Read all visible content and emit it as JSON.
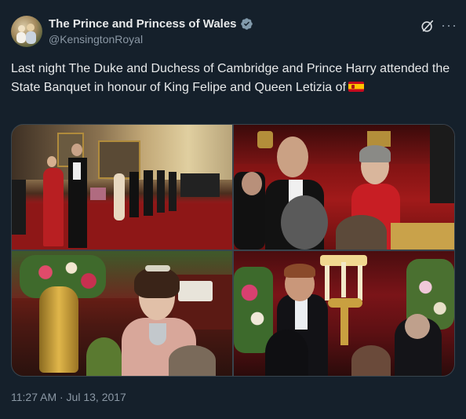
{
  "author": {
    "name": "The Prince and Princess of Wales",
    "handle": "@KensingtonRoyal",
    "verified_icon": "verified-badge-icon"
  },
  "header_icons": [
    "grok-icon",
    "more-options-icon"
  ],
  "more_label": "···",
  "tweet": {
    "text": "Last night The Duke and Duchess of Cambridge and Prince Harry attended the State Banquet in honour of King Felipe and Queen Letizia of",
    "emoji": "flag-spain"
  },
  "photos": [
    {
      "label": "photo-1"
    },
    {
      "label": "photo-2"
    },
    {
      "label": "photo-3"
    },
    {
      "label": "photo-4"
    }
  ],
  "timestamp": "11:27 AM · Jul 13, 2017",
  "colors": {
    "background": "#15202b",
    "text": "#e7e9ea",
    "secondary": "#8b98a5",
    "verified": "#829aab",
    "border": "#38444d"
  }
}
